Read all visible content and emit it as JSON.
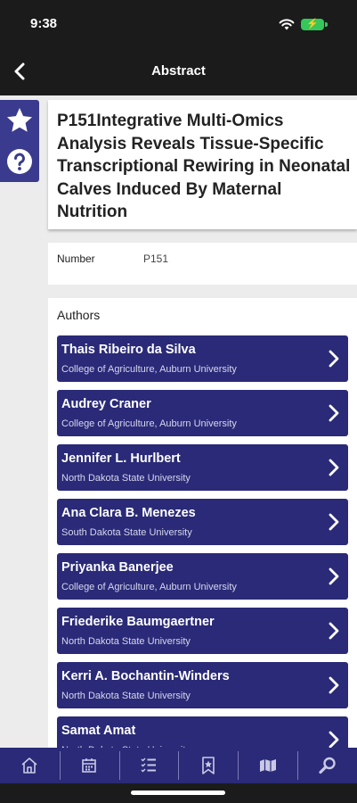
{
  "status_bar": {
    "time": "9:38"
  },
  "nav": {
    "title": "Abstract",
    "back_icon": "chevron-left-icon"
  },
  "side_actions": [
    {
      "name": "favorite",
      "icon": "star-icon"
    },
    {
      "name": "help",
      "icon": "question-icon"
    }
  ],
  "abstract": {
    "title": "P151Integrative Multi-Omics Analysis Reveals Tissue-Specific Transcriptional Rewiring in Neonatal Calves Induced By Maternal Nutrition",
    "number_label": "Number",
    "number_value": "P151"
  },
  "authors": {
    "heading": "Authors",
    "items": [
      {
        "name": "Thais Ribeiro da Silva",
        "affiliation": "College of Agriculture, Auburn University"
      },
      {
        "name": "Audrey Craner",
        "affiliation": "College of Agriculture, Auburn University"
      },
      {
        "name": "Jennifer L. Hurlbert",
        "affiliation": "North Dakota State University"
      },
      {
        "name": "Ana Clara B. Menezes",
        "affiliation": "South Dakota State University"
      },
      {
        "name": "Priyanka Banerjee",
        "affiliation": "College of Agriculture, Auburn University"
      },
      {
        "name": "Friederike Baumgaertner",
        "affiliation": "North Dakota State University"
      },
      {
        "name": "Kerri A. Bochantin-Winders",
        "affiliation": "North Dakota State University"
      },
      {
        "name": "Samat Amat",
        "affiliation": "North Dakota State University"
      }
    ]
  },
  "tab_bar": {
    "tabs": [
      {
        "name": "home",
        "icon": "home-icon"
      },
      {
        "name": "calendar",
        "icon": "calendar-icon"
      },
      {
        "name": "list",
        "icon": "list-icon"
      },
      {
        "name": "bookmarks",
        "icon": "bookmark-icon"
      },
      {
        "name": "map",
        "icon": "map-icon"
      },
      {
        "name": "search",
        "icon": "search-icon"
      }
    ]
  },
  "colors": {
    "accent": "#2a2a78",
    "side_panel": "#3a3a8e",
    "bars": "#1b1b1b",
    "battery": "#35c759"
  }
}
